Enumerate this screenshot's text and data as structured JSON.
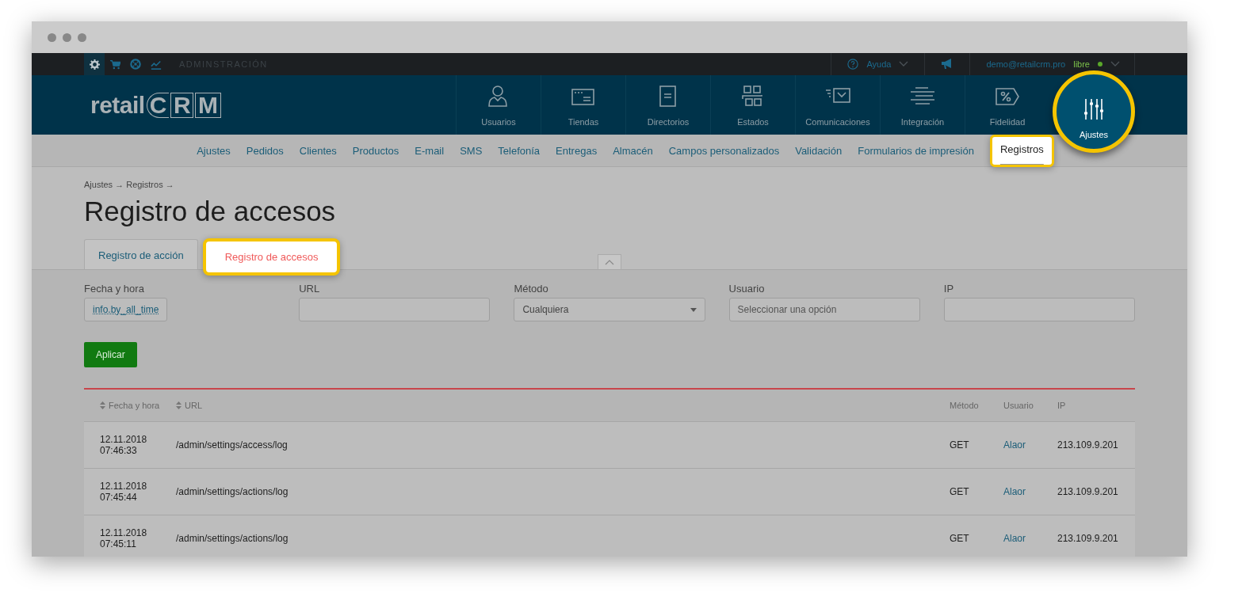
{
  "topbar": {
    "icons": [
      {
        "kind": "gear",
        "selected": true
      },
      {
        "kind": "cart",
        "selected": false
      },
      {
        "kind": "lifebuoy",
        "selected": false
      },
      {
        "kind": "chart",
        "selected": false
      }
    ],
    "section_label": "ADMINSTRACIÓN",
    "help": "Ayuda",
    "user": "demo@retailcrm.pro",
    "plan": "libre"
  },
  "logo": {
    "text": "retail",
    "mark": [
      "C",
      "R",
      "M"
    ]
  },
  "main_nav": [
    {
      "label": "Usuarios",
      "kind": "user",
      "selected": false
    },
    {
      "label": "Tiendas",
      "kind": "window",
      "selected": false
    },
    {
      "label": "Directorios",
      "kind": "document",
      "selected": false
    },
    {
      "label": "Estados",
      "kind": "grid",
      "selected": false
    },
    {
      "label": "Comunicaciones",
      "kind": "mail",
      "selected": false
    },
    {
      "label": "Integración",
      "kind": "lines",
      "selected": false
    },
    {
      "label": "Fidelidad",
      "kind": "percent",
      "selected": false
    },
    {
      "label": "Ajustes",
      "kind": "sliders",
      "selected": true
    }
  ],
  "sub_nav": [
    {
      "label": "Ajustes",
      "selected": false
    },
    {
      "label": "Pedidos",
      "selected": false
    },
    {
      "label": "Clientes",
      "selected": false
    },
    {
      "label": "Productos",
      "selected": false
    },
    {
      "label": "E-mail",
      "selected": false
    },
    {
      "label": "SMS",
      "selected": false
    },
    {
      "label": "Telefonía",
      "selected": false
    },
    {
      "label": "Entregas",
      "selected": false
    },
    {
      "label": "Almacén",
      "selected": false
    },
    {
      "label": "Campos personalizados",
      "selected": false
    },
    {
      "label": "Validación",
      "selected": false
    },
    {
      "label": "Formularios de impresión",
      "selected": false
    },
    {
      "label": "Registros",
      "selected": true
    }
  ],
  "breadcrumb": "Ajustes → Registros →",
  "title": "Registro de accesos",
  "tabs": [
    {
      "label": "Registro de acción",
      "selected": false
    },
    {
      "label": "Registro de accesos",
      "selected": true
    }
  ],
  "filters": [
    {
      "label": "Fecha y hora",
      "kind": "chip",
      "value": "info.by_all_time"
    },
    {
      "label": "URL",
      "kind": "input"
    },
    {
      "label": "Método",
      "kind": "select",
      "value": "Cualquiera"
    },
    {
      "label": "Usuario",
      "kind": "input",
      "placeholder": "Seleccionar una opción"
    },
    {
      "label": "IP",
      "kind": "input"
    }
  ],
  "apply_button": "Aplicar",
  "table": {
    "columns": [
      {
        "label": "Fecha y hora",
        "sortable": true
      },
      {
        "label": "URL",
        "sortable": true
      },
      {
        "label": "Método",
        "sortable": false
      },
      {
        "label": "Usuario",
        "sortable": false
      },
      {
        "label": "IP",
        "sortable": false
      }
    ],
    "rows": [
      {
        "date": "12.11.2018",
        "time": "07:46:33",
        "url": "/admin/settings/access/log",
        "method": "GET",
        "user": "Alaor",
        "ip": "213.109.9.201"
      },
      {
        "date": "12.11.2018",
        "time": "07:45:44",
        "url": "/admin/settings/actions/log",
        "method": "GET",
        "user": "Alaor",
        "ip": "213.109.9.201"
      },
      {
        "date": "12.11.2018",
        "time": "07:45:11",
        "url": "/admin/settings/actions/log",
        "method": "GET",
        "user": "Alaor",
        "ip": "213.109.9.201"
      }
    ]
  }
}
